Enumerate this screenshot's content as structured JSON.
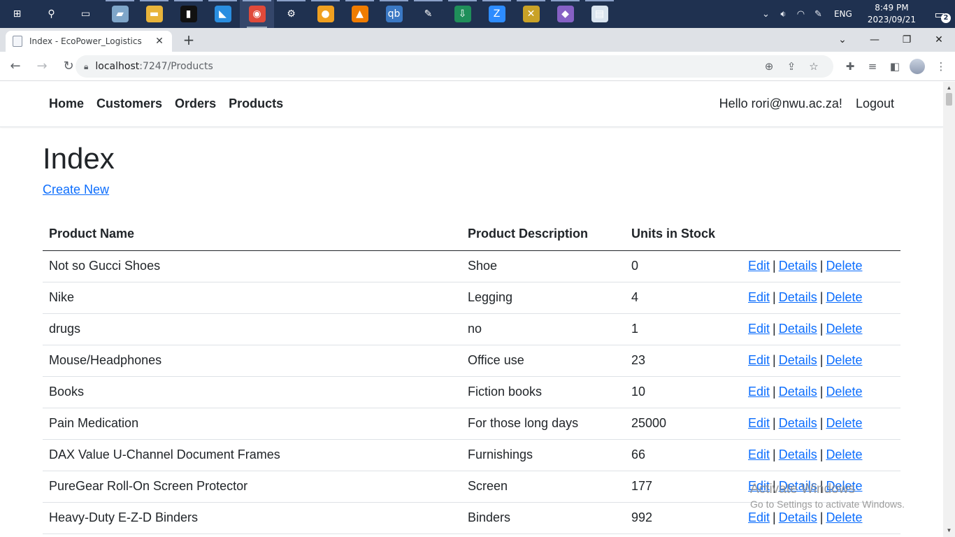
{
  "taskbar": {
    "apps": [
      {
        "icon": "windows-start-icon",
        "glyph": "⊞",
        "color": "#1f3150"
      },
      {
        "icon": "search-icon",
        "glyph": "⚲",
        "color": "#1f3150"
      },
      {
        "icon": "task-view-icon",
        "glyph": "▭",
        "color": "#1f3150"
      },
      {
        "icon": "notebook-app-icon",
        "glyph": "▰",
        "color": "#7fa6c9"
      },
      {
        "icon": "file-explorer-icon",
        "glyph": "▬",
        "color": "#e8b43a"
      },
      {
        "icon": "terminal-icon",
        "glyph": "▮",
        "color": "#111111"
      },
      {
        "icon": "vscode-icon",
        "glyph": "◣",
        "color": "#2a8ee0"
      },
      {
        "icon": "chrome-icon",
        "glyph": "◉",
        "color": "#e04a3a"
      },
      {
        "icon": "settings-gear-icon",
        "glyph": "⚙",
        "color": "#1f3150"
      },
      {
        "icon": "fl-studio-icon",
        "glyph": "●",
        "color": "#f0a020"
      },
      {
        "icon": "vlc-icon",
        "glyph": "▲",
        "color": "#f07c00"
      },
      {
        "icon": "qbittorrent-icon",
        "glyph": "qb",
        "color": "#3a78c4"
      },
      {
        "icon": "inkscape-icon",
        "glyph": "✎",
        "color": "#1f3150"
      },
      {
        "icon": "download-app-icon",
        "glyph": "⇩",
        "color": "#1f8f5a"
      },
      {
        "icon": "zoom-icon",
        "glyph": "Z",
        "color": "#2d8cff"
      },
      {
        "icon": "tools-app-icon",
        "glyph": "✕",
        "color": "#c9a227"
      },
      {
        "icon": "visual-studio-icon",
        "glyph": "◆",
        "color": "#8661c5"
      },
      {
        "icon": "reader-app-icon",
        "glyph": "▤",
        "color": "#d9e4ef"
      }
    ],
    "tray": {
      "language": "ENG",
      "time": "8:49 PM",
      "date": "2023/09/21",
      "notification_count": "2"
    }
  },
  "browser": {
    "tab_title": "Index - EcoPower_Logistics",
    "url_host": "localhost",
    "url_rest": ":7247/Products"
  },
  "nav": {
    "links": [
      "Home",
      "Customers",
      "Orders",
      "Products"
    ],
    "greeting": "Hello rori@nwu.ac.za!",
    "logout": "Logout"
  },
  "page": {
    "title": "Index",
    "create_link": "Create New"
  },
  "table": {
    "headers": [
      "Product Name",
      "Product Description",
      "Units in Stock",
      ""
    ],
    "action_labels": {
      "edit": "Edit",
      "details": "Details",
      "delete": "Delete",
      "separator": "|"
    },
    "rows": [
      {
        "name": "Not so Gucci Shoes",
        "description": "Shoe",
        "units": "0"
      },
      {
        "name": "Nike",
        "description": "Legging",
        "units": "4"
      },
      {
        "name": "drugs",
        "description": "no",
        "units": "1"
      },
      {
        "name": "Mouse/Headphones",
        "description": "Office use",
        "units": "23"
      },
      {
        "name": "Books",
        "description": "Fiction books",
        "units": "10"
      },
      {
        "name": "Pain Medication",
        "description": "For those long days",
        "units": "25000"
      },
      {
        "name": "DAX Value U-Channel Document Frames",
        "description": "Furnishings",
        "units": "66"
      },
      {
        "name": "PureGear Roll-On Screen Protector",
        "description": "Screen",
        "units": "177"
      },
      {
        "name": "Heavy-Duty E-Z-D Binders",
        "description": "Binders",
        "units": "992"
      }
    ]
  },
  "watermark": {
    "line1": "Activate Windows",
    "line2": "Go to Settings to activate Windows."
  },
  "colors": {
    "taskbar": "#1f3150",
    "link": "#0d6efd",
    "text": "#212529",
    "tabstrip": "#dee1e6"
  }
}
